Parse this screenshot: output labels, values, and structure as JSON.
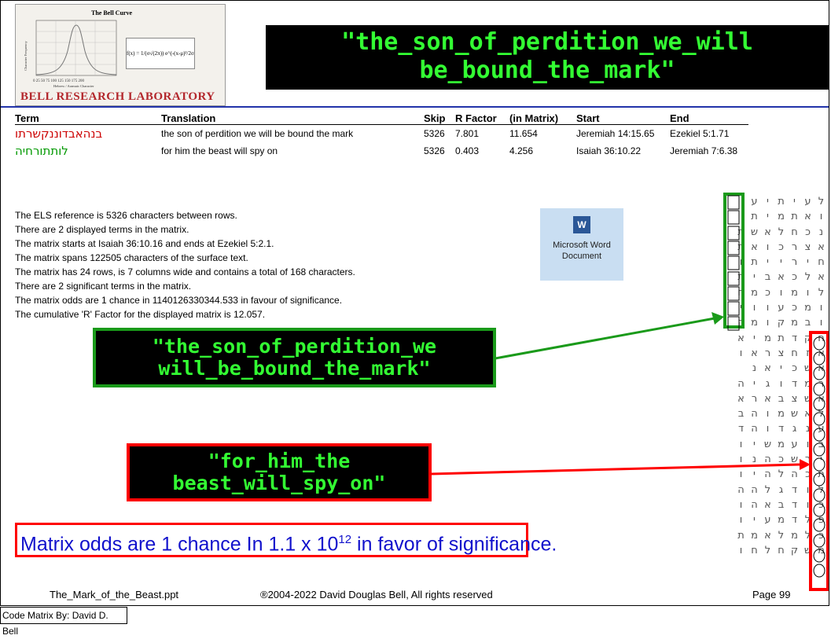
{
  "logo": {
    "chart_title": "The Bell Curve",
    "y_axis_label": "Character Frequency",
    "x_axis_label": "Hebrew / Aramaic Character",
    "x_ticks": "0  25  50  75  100 125 150 175 200",
    "formula": "f(x) = 1/(σ√(2π)) e^(-(x-μ)²/2σ²)",
    "lab_name": "BELL RESEARCH LABORATORY"
  },
  "title": {
    "line1": "\"the_son_of_perdition_we_will",
    "line2": "be_bound_the_mark\""
  },
  "table": {
    "headers": [
      "Term",
      "Translation",
      "Skip",
      "R Factor",
      "(in Matrix)",
      "Start",
      "End"
    ],
    "rows": [
      {
        "term": "בנהאבדוננקשרתו",
        "translation": "the son of perdition we will be bound the mark",
        "skip": "5326",
        "rfactor": "7.801",
        "in_matrix": "11.654",
        "start": "Jeremiah 14:15.65",
        "end": "Ezekiel 5:1.71",
        "color": "#cc0000"
      },
      {
        "term": "לותתורחיה",
        "translation": "for him the beast will spy on",
        "skip": "5326",
        "rfactor": "0.403",
        "in_matrix": "4.256",
        "start": "Isaiah 36:10.22",
        "end": "Jeremiah 7:6.38",
        "color": "#009900"
      }
    ]
  },
  "info_lines": [
    "The ELS reference is 5326 characters between rows.",
    "There are 2 displayed terms in the matrix.",
    "The matrix starts at Isaiah 36:10.16 and ends at Ezekiel 5:2.1.",
    "The matrix spans 122505 characters of the surface text.",
    "The matrix has 24 rows, is 7 columns wide and contains a total of 168 characters.",
    "There are 2 significant terms in the matrix.",
    "The matrix odds are 1 chance in 1140126330344.533 in favour of significance.",
    "The cumulative 'R' Factor for the displayed matrix is 12.057."
  ],
  "word_icon": {
    "badge": "W",
    "line1": "Microsoft Word",
    "line2": "Document"
  },
  "callout_green": {
    "line1": "\"the_son_of_perdition_we",
    "line2": "will_be_bound_the_mark\""
  },
  "callout_red": {
    "line1": "\"for_him_the",
    "line2": "beast_will_spy_on\""
  },
  "odds": {
    "prefix": "Matrix odds are 1 chance In 1.1 x 10",
    "exponent": "12",
    "suffix": " in favor of significance."
  },
  "matrix_rows": [
    "לעיתיע",
    "ואתמית",
    "נכחלאשת",
    "אצרכואת",
    "חירייתו",
    "אלכאבית",
    "לומוכמח",
    "ומכעוויי",
    "ובמקומה",
    "חקדתמיא",
    "אזחצראו",
    "אשכיאנ",
    "רמדוגיה",
    "אשצבארא",
    "לאשמוהב",
    "ענגדוהד",
    "בועמשיו",
    "ירשכהנו",
    "תכהלהיו",
    "לודגלהה",
    "כודבאהו",
    "פלדמעיו",
    "כלמלאמת",
    "משקחלחו"
  ],
  "colors": {
    "accent_green": "#1a9a1a",
    "accent_red": "#ff0000",
    "blue_rule": "#2233aa",
    "callout_green_text": "#33ff33",
    "callout_red_text": "#33ff33"
  },
  "footer": {
    "file": "The_Mark_of_the_Beast.ppt",
    "copyright": "®2004-2022 David Douglas Bell, All rights reserved",
    "page": "Page 99",
    "code_by": "Code Matrix By: David D. Bell"
  }
}
